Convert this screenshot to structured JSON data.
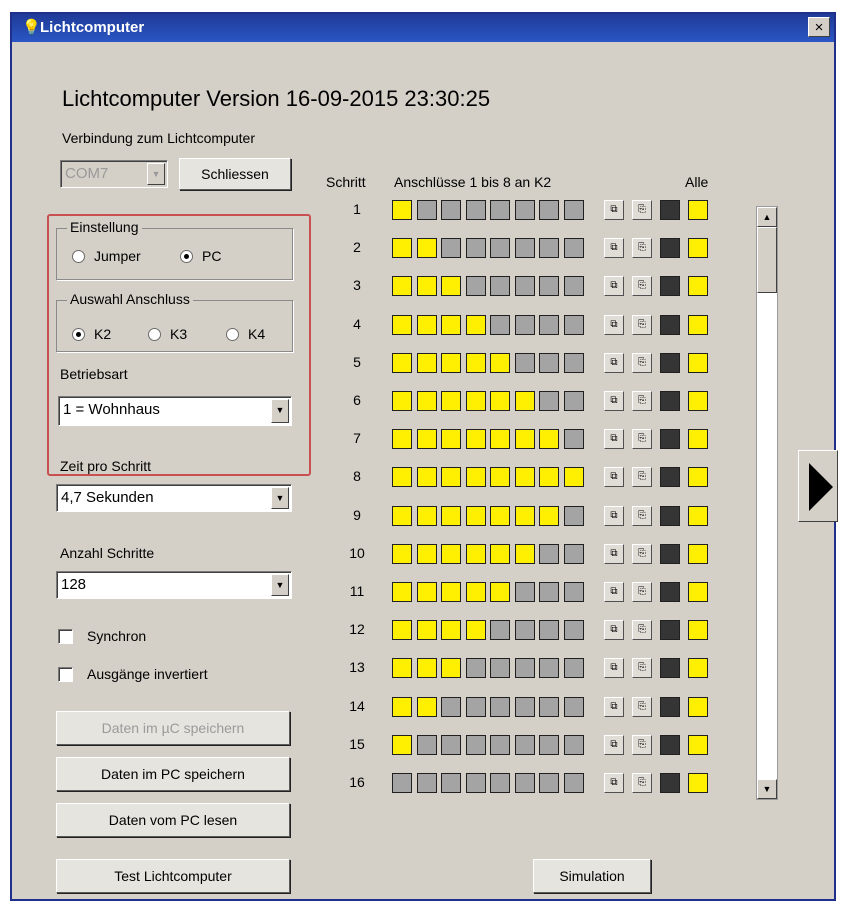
{
  "window": {
    "title": "Lichtcomputer",
    "close_label": "×"
  },
  "heading": "Lichtcomputer Version 16-09-2015 23:30:25",
  "connection": {
    "label": "Verbindung zum Lichtcomputer",
    "port": "COM7",
    "close_button": "Schliessen"
  },
  "einstellung": {
    "title": "Einstellung",
    "options": [
      {
        "label": "Jumper",
        "selected": false
      },
      {
        "label": "PC",
        "selected": true
      }
    ]
  },
  "anschluss": {
    "title": "Auswahl Anschluss",
    "options": [
      {
        "label": "K2",
        "selected": true
      },
      {
        "label": "K3",
        "selected": false
      },
      {
        "label": "K4",
        "selected": false
      }
    ]
  },
  "betriebsart": {
    "label": "Betriebsart",
    "value": "1 = Wohnhaus"
  },
  "zeit": {
    "label": "Zeit pro Schritt",
    "value": "4,7 Sekunden"
  },
  "anzahl": {
    "label": "Anzahl Schritte",
    "value": "128"
  },
  "checkboxes": [
    {
      "label": "Synchron",
      "checked": false
    },
    {
      "label": "Ausgänge invertiert",
      "checked": false
    }
  ],
  "buttons": {
    "save_uc": "Daten im µC speichern",
    "save_pc": "Daten im PC speichern",
    "read_pc": "Daten vom PC lesen",
    "test": "Test Lichtcomputer",
    "simulation": "Simulation"
  },
  "grid": {
    "header_step": "Schritt",
    "header_ports": "Anschlüsse 1 bis 8 an K2",
    "header_all": "Alle",
    "on_color": "#ffef00",
    "off_color": "#a4a4a4",
    "steps": [
      {
        "n": "1",
        "on": 1
      },
      {
        "n": "2",
        "on": 2
      },
      {
        "n": "3",
        "on": 3
      },
      {
        "n": "4",
        "on": 4
      },
      {
        "n": "5",
        "on": 5
      },
      {
        "n": "6",
        "on": 6
      },
      {
        "n": "7",
        "on": 7
      },
      {
        "n": "8",
        "on": 8
      },
      {
        "n": "9",
        "on": 7
      },
      {
        "n": "10",
        "on": 6
      },
      {
        "n": "11",
        "on": 5
      },
      {
        "n": "12",
        "on": 4
      },
      {
        "n": "13",
        "on": 3
      },
      {
        "n": "14",
        "on": 2
      },
      {
        "n": "15",
        "on": 1
      },
      {
        "n": "16",
        "on": 0
      }
    ]
  }
}
